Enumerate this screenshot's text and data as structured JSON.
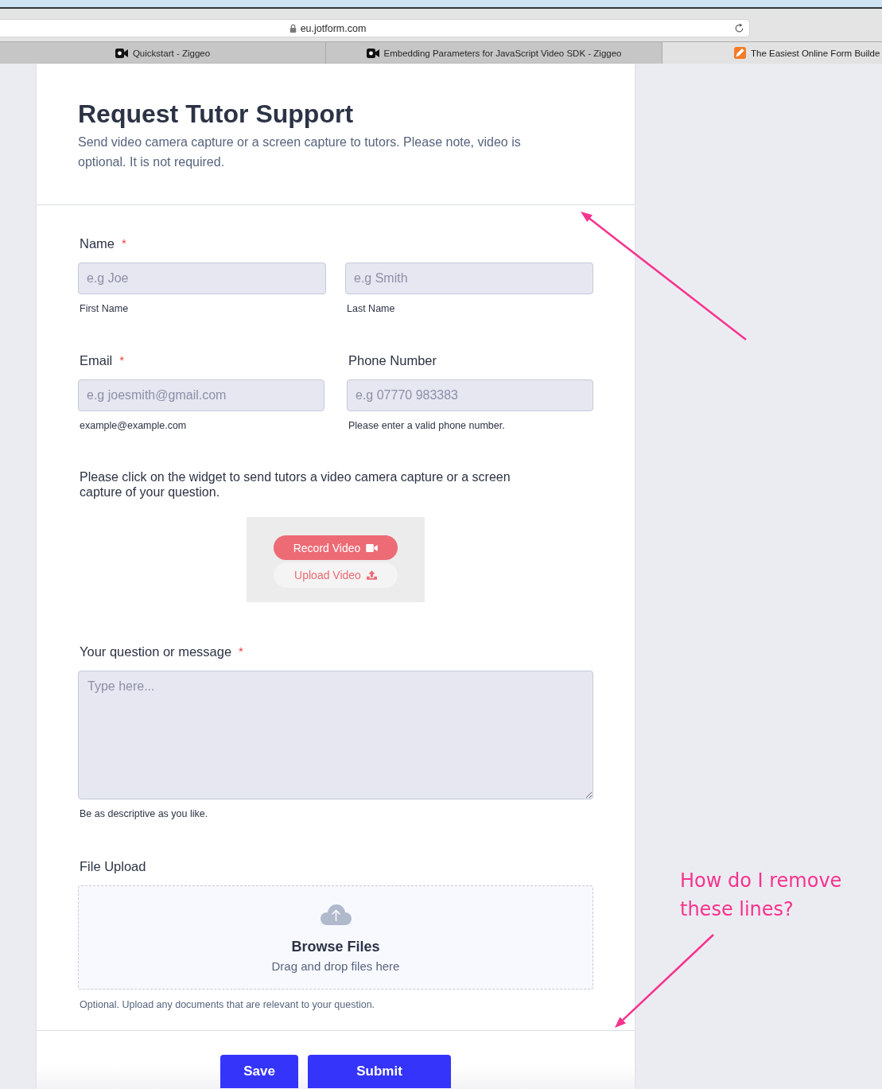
{
  "browser": {
    "address": "eu.jotform.com",
    "tabs": [
      {
        "title": "Quickstart - Ziggeo",
        "kind": "video",
        "selected": false
      },
      {
        "title": "Embedding Parameters for JavaScript Video SDK - Ziggeo",
        "kind": "video",
        "selected": false
      },
      {
        "title": "The Easiest Online Form Builde",
        "kind": "form",
        "selected": true
      }
    ]
  },
  "form": {
    "title": "Request Tutor Support",
    "description": "Send video camera capture or a screen capture to tutors. Please note, video is optional. It is not required.",
    "rows": [
      {
        "kind": "fullname",
        "label": "Name",
        "required_mark": "*",
        "inputs": [
          {
            "placeholder": "e.g Joe",
            "sublabel": "First Name"
          },
          {
            "placeholder": "e.g Smith",
            "sublabel": "Last Name"
          }
        ]
      },
      {
        "kind": "pair",
        "fields": [
          {
            "label": "Email",
            "required_mark": "*",
            "placeholder": "e.g joesmith@gmail.com",
            "sublabel": "example@example.com"
          },
          {
            "label": "Phone Number",
            "placeholder": "e.g 07770 983383",
            "sublabel": "Please enter a valid phone number."
          }
        ]
      },
      {
        "kind": "text",
        "text": "Please click on the widget to send tutors a video camera capture or a screen capture of your question."
      },
      {
        "kind": "video",
        "buttons": [
          {
            "label": "Record Video",
            "kind": "record"
          },
          {
            "label": "Upload Video",
            "kind": "upload"
          }
        ]
      },
      {
        "kind": "textarea",
        "label": "Your question or message",
        "required_mark": "*",
        "placeholder": "Type here...",
        "sublabel": "Be as descriptive as you like."
      },
      {
        "kind": "upload",
        "label": "File Upload",
        "title": "Browse Files",
        "hint": "Drag and drop files here",
        "sublabel": "Optional. Upload any documents that are relevant to your question."
      }
    ],
    "buttons": [
      {
        "label": "Save",
        "kind": "save"
      },
      {
        "label": "Submit",
        "kind": "submit"
      }
    ]
  },
  "annotation": {
    "text": "How do I remove these lines?"
  }
}
